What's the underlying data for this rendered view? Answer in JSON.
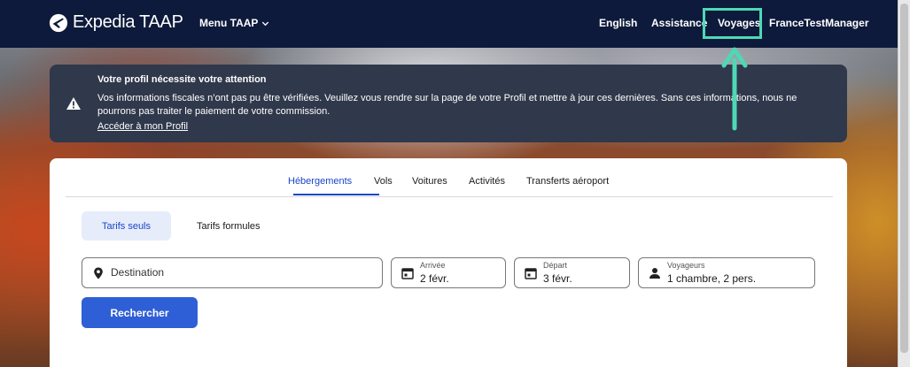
{
  "header": {
    "brand": "Expedia TAAP",
    "menu_label": "Menu TAAP",
    "nav": {
      "language": "English",
      "help": "Assistance",
      "trips": "Voyages",
      "account": "FranceTestManager"
    }
  },
  "alert": {
    "title": "Votre profil nécessite votre attention",
    "message": "Vos informations fiscales n’ont pas pu être vérifiées. Veuillez vous rendre sur la page de votre Profil et mettre à jour ces dernières. Sans ces informations, nous ne pourrons pas traiter le paiement de votre commission.",
    "link": "Accéder à mon Profil"
  },
  "tabs": [
    {
      "label": "Hébergements",
      "active": true
    },
    {
      "label": "Vols",
      "active": false
    },
    {
      "label": "Voitures",
      "active": false
    },
    {
      "label": "Activités",
      "active": false
    },
    {
      "label": "Transferts aéroport",
      "active": false
    }
  ],
  "rate_toggle": {
    "selected": "Tarifs seuls",
    "other": "Tarifs formules"
  },
  "search": {
    "destination_placeholder": "Destination",
    "arrival_label": "Arrivée",
    "arrival_value": "2 févr.",
    "departure_label": "Départ",
    "departure_value": "3 févr.",
    "travelers_label": "Voyageurs",
    "travelers_value": "1 chambre, 2 pers.",
    "submit": "Rechercher"
  },
  "colors": {
    "header_bg": "#0d1a3b",
    "alert_bg": "#30384b",
    "accent": "#2f5fd6",
    "highlight": "#4fd8b5"
  },
  "icons": [
    "expedia-logo-icon",
    "chevron-down-icon",
    "warning-icon",
    "location-pin-icon",
    "calendar-icon",
    "person-icon",
    "annotation-arrow-icon"
  ]
}
